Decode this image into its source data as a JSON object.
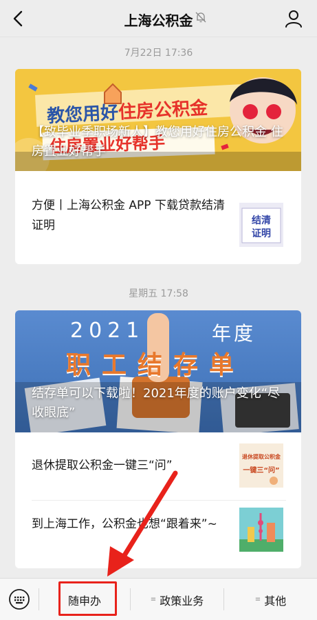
{
  "header": {
    "title": "上海公积金"
  },
  "timestamps": [
    "7月22日 17:36",
    "星期五 17:58"
  ],
  "card1": {
    "banner_line1a": "教您用好",
    "banner_line1b": "住房公积金",
    "banner_line2": "住房置业好帮手",
    "cover_title": "【致毕业季职场新人】教您用好住房公积金 住房置业好帮手",
    "items": [
      {
        "title": "方便丨上海公积金 APP 下载贷款结清证明",
        "thumb_text": "结清证明"
      }
    ]
  },
  "card2": {
    "banner_year": "2021",
    "banner_suffix": "年度",
    "banner_main": "职工结存单",
    "cover_title": "结存单可以下载啦！2021年度的账户变化“尽收眼底”",
    "items": [
      {
        "title": "退休提取公积金一键三“问”",
        "thumb_line1": "退休提取公积金",
        "thumb_line2": "一键三“问”"
      },
      {
        "title": "到上海工作，公积金也想“跟着来”~"
      }
    ]
  },
  "bottom_menu": [
    "随申办",
    "政策业务",
    "其他"
  ],
  "colors": {
    "highlight": "#e8221b",
    "background": "#ededed",
    "banner_yellow": "#f3c640",
    "banner_blue": "#4d7fc4"
  }
}
